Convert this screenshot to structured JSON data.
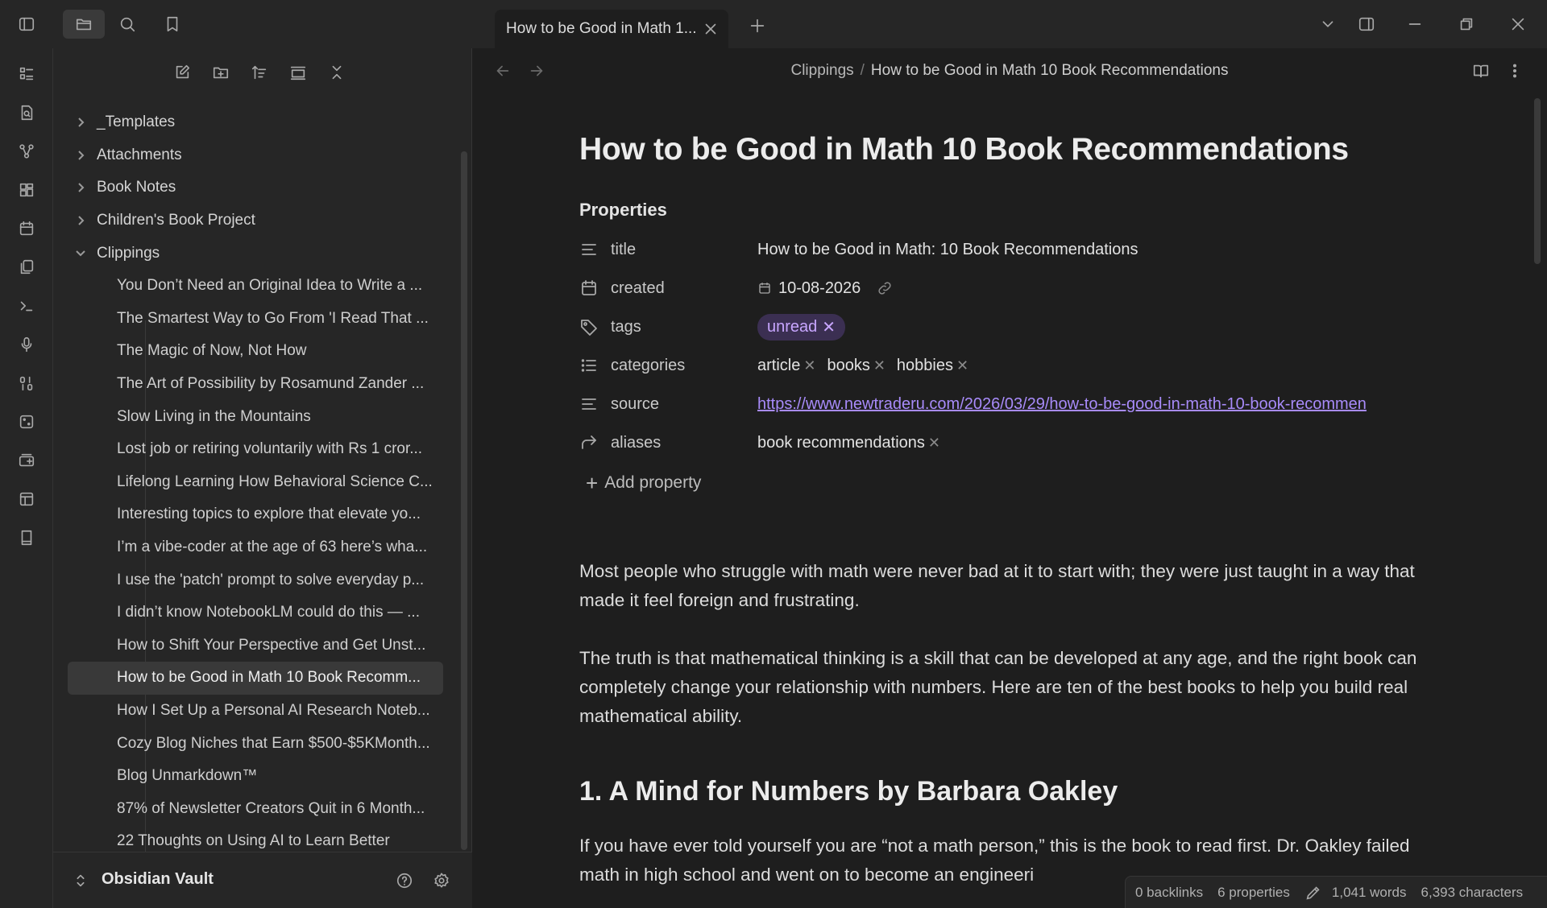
{
  "app": {
    "vault_name": "Obsidian Vault"
  },
  "tab": {
    "title": "How to be Good in Math 1..."
  },
  "breadcrumb": {
    "folder": "Clippings",
    "separator": "/",
    "current": "How to be Good in Math 10 Book Recommendations"
  },
  "tree": {
    "folders": [
      {
        "label": "_Templates"
      },
      {
        "label": "Attachments"
      },
      {
        "label": "Book Notes"
      },
      {
        "label": "Children's Book Project"
      },
      {
        "label": "Clippings"
      }
    ],
    "files": [
      {
        "label": "You Don’t Need an Original Idea to Write a ..."
      },
      {
        "label": "The Smartest Way to Go From 'I Read That ..."
      },
      {
        "label": "The Magic of Now, Not How"
      },
      {
        "label": "The Art of Possibility by Rosamund Zander ..."
      },
      {
        "label": "Slow Living in the Mountains"
      },
      {
        "label": "Lost job or retiring voluntarily with Rs 1 cror..."
      },
      {
        "label": "Lifelong Learning How Behavioral Science C..."
      },
      {
        "label": "Interesting topics to explore that elevate yo..."
      },
      {
        "label": "I’m a vibe-coder at the age of 63 here’s wha..."
      },
      {
        "label": "I use the 'patch' prompt to solve everyday p..."
      },
      {
        "label": "I didn’t know NotebookLM could do this — ..."
      },
      {
        "label": "How to Shift Your Perspective and Get Unst..."
      },
      {
        "label": "How to be Good in Math 10 Book Recomm..."
      },
      {
        "label": "How I Set Up a Personal AI Research Noteb..."
      },
      {
        "label": "Cozy Blog Niches that Earn $500-$5KMonth..."
      },
      {
        "label": "Blog  Unmarkdown™"
      },
      {
        "label": "87% of Newsletter Creators Quit in 6 Month..."
      },
      {
        "label": "22 Thoughts on Using AI to Learn Better"
      }
    ]
  },
  "doc": {
    "title": "How to be Good in Math 10 Book Recommendations",
    "properties_heading": "Properties",
    "properties": {
      "title": {
        "key": "title",
        "value": "How to be Good in Math: 10 Book Recommendations"
      },
      "created": {
        "key": "created",
        "value": "10-08-2026"
      },
      "tags": {
        "key": "tags",
        "values": [
          "unread"
        ]
      },
      "categories": {
        "key": "categories",
        "values": [
          "article",
          "books",
          "hobbies"
        ]
      },
      "source": {
        "key": "source",
        "value": "https://www.newtraderu.com/2026/03/29/how-to-be-good-in-math-10-book-recommen"
      },
      "aliases": {
        "key": "aliases",
        "values": [
          "book recommendations"
        ]
      }
    },
    "add_property": "Add property",
    "paragraphs": [
      "Most people who struggle with math were never bad at it to start with; they were just taught in a way that made it feel foreign and frustrating.",
      "The truth is that mathematical thinking is a skill that can be developed at any age, and the right book can completely change your relationship with numbers. Here are ten of the best books to help you build real mathematical ability."
    ],
    "heading_1": "1. A Mind for Numbers by Barbara Oakley",
    "paragraph_3": "If you have ever told yourself you are “not a math person,” this is the book to read first. Dr. Oakley failed math in high school and went on to become an engineeri"
  },
  "status": {
    "backlinks": "0 backlinks",
    "properties": "6 properties",
    "words": "1,041 words",
    "characters": "6,393 characters"
  },
  "colors": {
    "background": "#1e1e1e",
    "sidebar": "#262626",
    "accent": "#a88bfa",
    "tag_bg": "#3b2f52"
  }
}
